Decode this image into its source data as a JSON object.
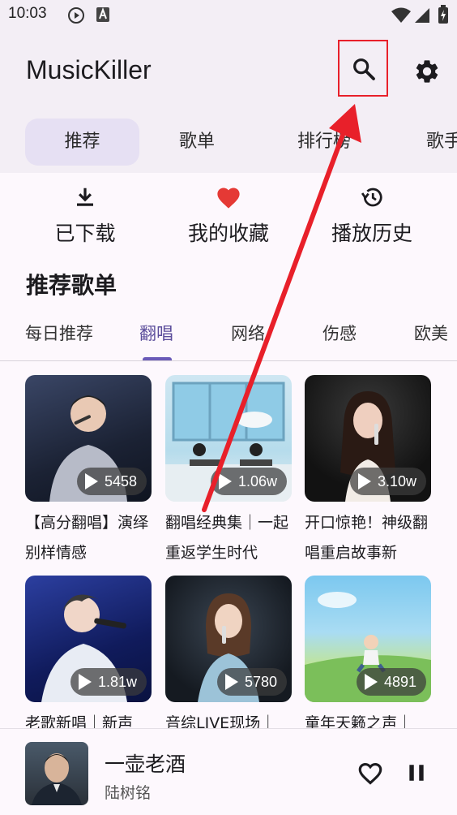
{
  "status_bar": {
    "time": "10:03",
    "icons": [
      "media-play-icon",
      "a-badge-icon",
      "wifi-icon",
      "signal-icon",
      "battery-charging-icon"
    ]
  },
  "app": {
    "title": "MusicKiller",
    "search_icon": "search-icon",
    "settings_icon": "gear-icon"
  },
  "tabs": [
    "推荐",
    "歌单",
    "排行榜",
    "歌手"
  ],
  "active_tab": "推荐",
  "quick_actions": [
    {
      "label": "已下载",
      "icon": "download-icon"
    },
    {
      "label": "我的收藏",
      "icon": "heart-icon"
    },
    {
      "label": "播放历史",
      "icon": "history-icon"
    }
  ],
  "section": {
    "title": "推荐歌单",
    "categories": [
      "每日推荐",
      "翻唱",
      "网络",
      "伤感",
      "欧美"
    ],
    "active_category": "翻唱"
  },
  "playlists": [
    {
      "title": "【高分翻唱】演绎别样情感",
      "plays": "5458"
    },
    {
      "title": "翻唱经典集｜一起重返学生时代",
      "plays": "1.06w"
    },
    {
      "title": "开口惊艳！神级翻唱重启故事新",
      "plays": "3.10w"
    },
    {
      "title": "老歌新唱｜新声",
      "plays": "1.81w"
    },
    {
      "title": "音综LIVE现场｜",
      "plays": "5780"
    },
    {
      "title": "童年天籁之声｜",
      "plays": "4891"
    }
  ],
  "now_playing": {
    "title": "一壶老酒",
    "artist": "陆树铭",
    "favorite_icon": "heart-outline-icon",
    "pause_icon": "pause-icon"
  },
  "colors": {
    "accent": "#6a5ab8",
    "tab_active_bg": "#e6e0f3",
    "favorite": "#e53935",
    "annotation": "#e8202a"
  }
}
